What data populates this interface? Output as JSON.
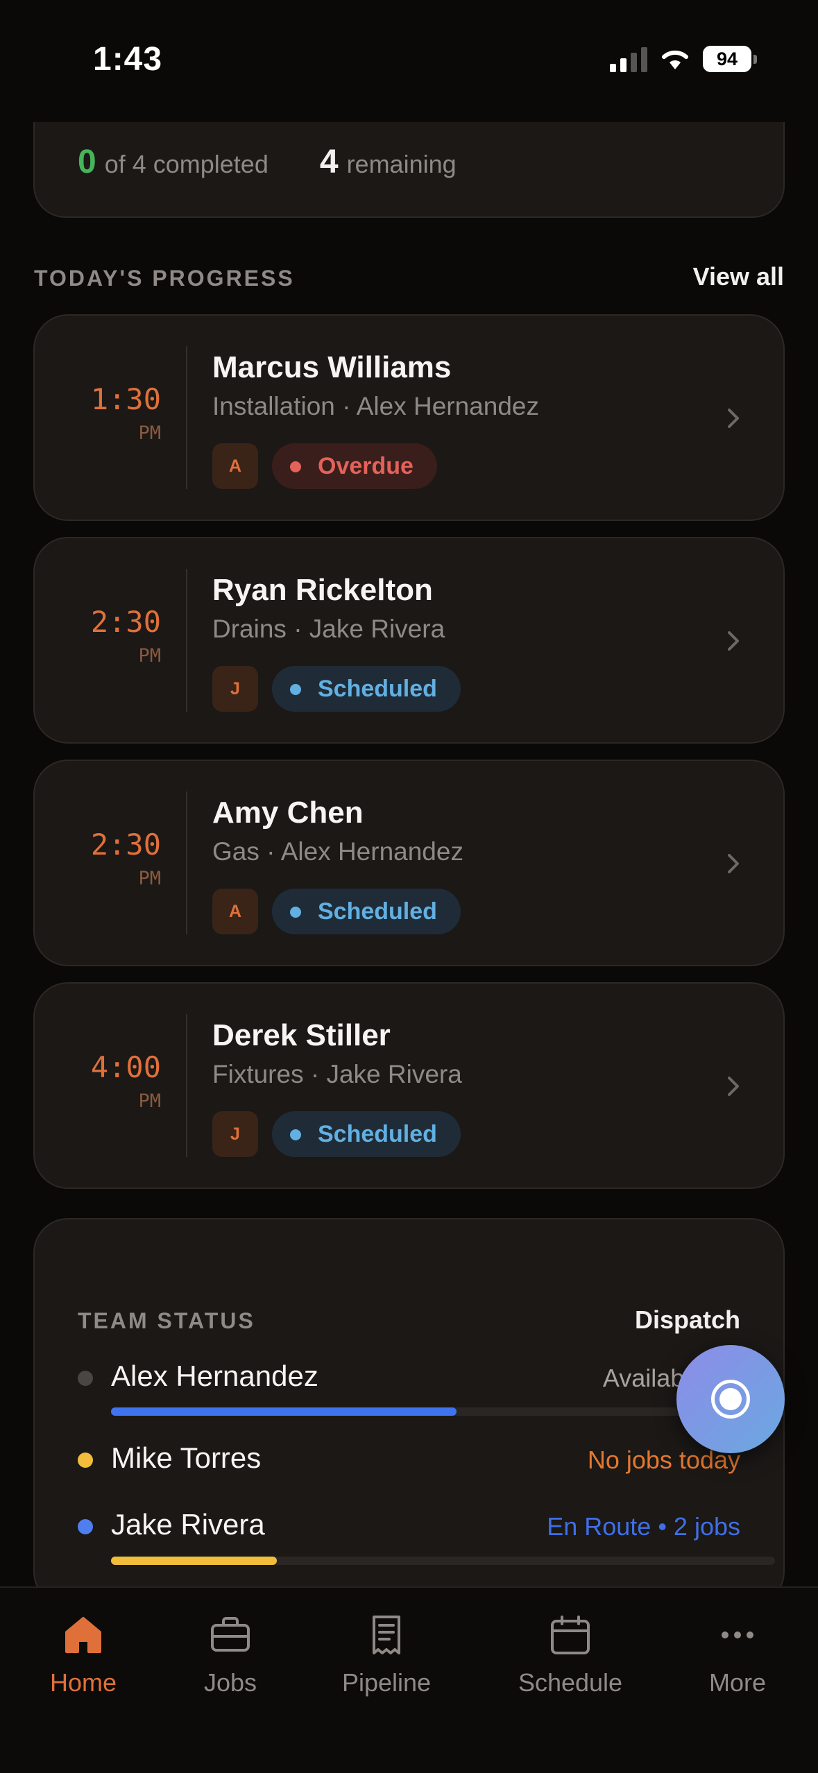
{
  "status_bar": {
    "time": "1:43",
    "battery": "94"
  },
  "summary": {
    "completed_count": "0",
    "completed_label": "of 4 completed",
    "remaining_count": "4",
    "remaining_label": "remaining"
  },
  "progress": {
    "title": "TODAY'S PROGRESS",
    "view_all": "View all",
    "jobs": [
      {
        "time": "1:30",
        "ampm": "PM",
        "name": "Marcus Williams",
        "sub": "Installation · Alex Hernandez",
        "initial": "A",
        "status": "Overdue"
      },
      {
        "time": "2:30",
        "ampm": "PM",
        "name": "Ryan Rickelton",
        "sub": "Drains · Jake Rivera",
        "initial": "J",
        "status": "Scheduled"
      },
      {
        "time": "2:30",
        "ampm": "PM",
        "name": "Amy Chen",
        "sub": "Gas · Alex Hernandez",
        "initial": "A",
        "status": "Scheduled"
      },
      {
        "time": "4:00",
        "ampm": "PM",
        "name": "Derek Stiller",
        "sub": "Fixtures · Jake Rivera",
        "initial": "J",
        "status": "Scheduled"
      }
    ]
  },
  "team": {
    "title": "TEAM STATUS",
    "dispatch": "Dispatch",
    "members": [
      {
        "name": "Alex Hernandez",
        "status": "Available • 2",
        "dot_color": "#4a4643",
        "status_color": "#a8a39e",
        "workload": 0.52,
        "bar_color": "#3f74f0"
      },
      {
        "name": "Mike Torres",
        "status": "No jobs today",
        "dot_color": "#f2bd3a",
        "status_color": "#e3782f"
      },
      {
        "name": "Jake Rivera",
        "status": "En Route • 2 jobs",
        "dot_color": "#4f7ef0",
        "status_color": "#3f6fe8",
        "workload": 0.25,
        "bar_color": "#f2bd3a"
      }
    ]
  },
  "tabs": [
    {
      "label": "Home",
      "icon": "home-icon",
      "active": true
    },
    {
      "label": "Jobs",
      "icon": "briefcase-icon"
    },
    {
      "label": "Pipeline",
      "icon": "receipt-icon"
    },
    {
      "label": "Schedule",
      "icon": "calendar-icon"
    },
    {
      "label": "More",
      "icon": "more-icon"
    }
  ],
  "colors": {
    "accent": "#e0703a",
    "overdue": "#e36259",
    "scheduled": "#62b0e2",
    "completed": "#46b45a"
  }
}
